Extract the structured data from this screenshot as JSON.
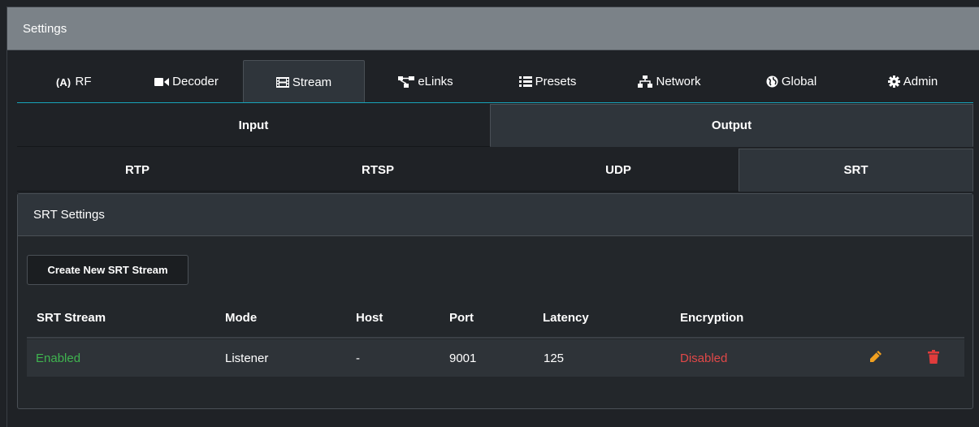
{
  "window": {
    "title": "Settings"
  },
  "main_tabs": [
    {
      "label": "RF",
      "icon": "antenna-icon"
    },
    {
      "label": "Decoder",
      "icon": "video-camera-icon"
    },
    {
      "label": "Stream",
      "icon": "film-icon"
    },
    {
      "label": "eLinks",
      "icon": "links-icon"
    },
    {
      "label": "Presets",
      "icon": "list-icon"
    },
    {
      "label": "Network",
      "icon": "sitemap-icon"
    },
    {
      "label": "Global",
      "icon": "globe-icon"
    },
    {
      "label": "Admin",
      "icon": "gear-icon"
    }
  ],
  "active_main_tab": "Stream",
  "direction_tabs": [
    {
      "label": "Input"
    },
    {
      "label": "Output"
    }
  ],
  "active_direction_tab": "Output",
  "protocol_tabs": [
    {
      "label": "RTP"
    },
    {
      "label": "RTSP"
    },
    {
      "label": "UDP"
    },
    {
      "label": "SRT"
    }
  ],
  "active_protocol_tab": "SRT",
  "srt_panel": {
    "title": "SRT Settings",
    "create_button": "Create New SRT Stream",
    "columns": [
      "SRT Stream",
      "Mode",
      "Host",
      "Port",
      "Latency",
      "Encryption"
    ],
    "rows": [
      {
        "stream": "Enabled",
        "mode": "Listener",
        "host": "-",
        "port": "9001",
        "latency": "125",
        "encryption": "Disabled"
      }
    ]
  },
  "colors": {
    "accent": "#17a2b8",
    "enabled": "#3fb34f",
    "disabled": "#e04848",
    "edit_icon": "#f0a020",
    "delete_icon": "#e03c3c"
  }
}
